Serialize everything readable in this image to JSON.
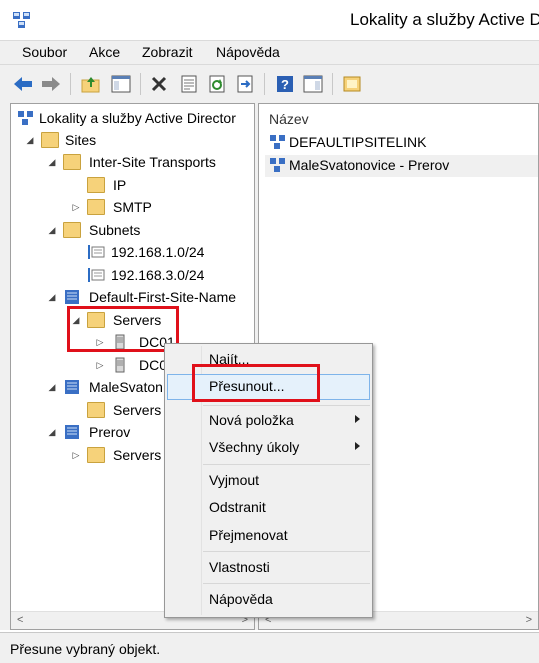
{
  "window": {
    "title": "Lokality a služby Active D"
  },
  "menu": {
    "items": [
      "Soubor",
      "Akce",
      "Zobrazit",
      "Nápověda"
    ]
  },
  "tree": {
    "root": "Lokality a služby Active Director",
    "sites": "Sites",
    "inter_site_transports": "Inter-Site Transports",
    "ip": "IP",
    "smtp": "SMTP",
    "subnets": "Subnets",
    "subnet1": "192.168.1.0/24",
    "subnet2": "192.168.3.0/24",
    "default_site": "Default-First-Site-Name",
    "servers1": "Servers",
    "dc01": "DC01",
    "dc02": "DC0",
    "malesvatonovice": "MaleSvaton",
    "servers2": "Servers",
    "prerov": "Prerov",
    "servers3": "Servers"
  },
  "list": {
    "column_header": "Název",
    "rows": [
      "DEFAULTIPSITELINK",
      "MaleSvatonovice - Prerov"
    ]
  },
  "context_menu": {
    "items": [
      "Najít...",
      "Přesunout...",
      "Nová položka",
      "Všechny úkoly",
      "Vyjmout",
      "Odstranit",
      "Přejmenovat",
      "Vlastnosti",
      "Nápověda"
    ]
  },
  "status": {
    "text": "Přesune vybraný objekt."
  },
  "colors": {
    "highlight_box": "#e0101a",
    "hover": "#e5f1fb",
    "hover_border": "#7eb4ea"
  }
}
